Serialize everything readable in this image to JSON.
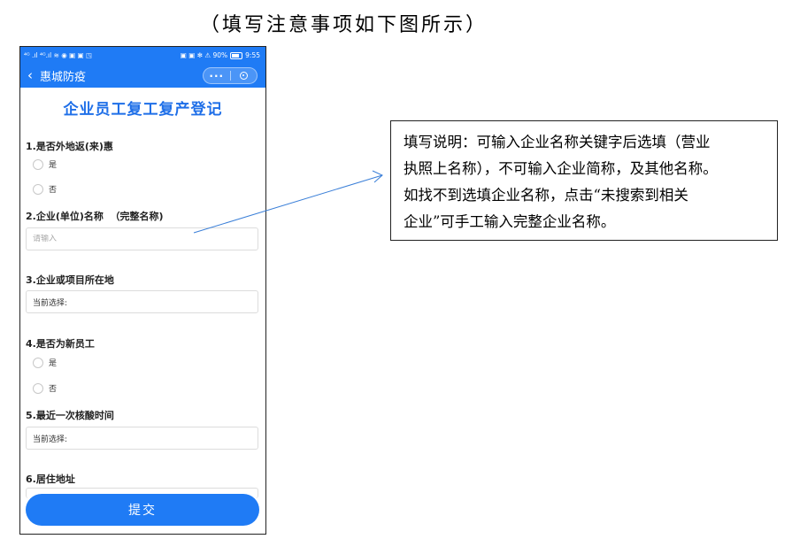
{
  "heading": "（填写注意事项如下图所示）",
  "phone": {
    "status_bar": {
      "left_text": "⁴ᴳ .ıl ⁴ᴳ.ıl ≋ ◉ ▣ ▣ ◳",
      "right_text": "▣ ▣ ✻ ⚠ 90%",
      "time": "9:55"
    },
    "nav": {
      "back_icon": "chevron-left-icon",
      "title": "惠城防疫",
      "more_label": "···",
      "close_icon": "target-icon"
    },
    "form": {
      "title": "企业员工复工复产登记",
      "q1": {
        "label": "1.是否外地返(来)惠",
        "options": [
          "是",
          "否"
        ]
      },
      "q2": {
        "label": "2.企业(单位)名称  （完整名称)",
        "placeholder": "请输入"
      },
      "q3": {
        "label": "3.企业或项目所在地",
        "value": "当前选择:"
      },
      "q4": {
        "label": "4.是否为新员工",
        "options": [
          "是",
          "否"
        ]
      },
      "q5": {
        "label": "5.最近一次核酸时间",
        "value": "当前选择:"
      },
      "q6": {
        "label": "6.居住地址"
      },
      "submit_label": "提交"
    },
    "colors": {
      "brand_blue": "#1f7bf5",
      "title_blue": "#1f6fe8"
    }
  },
  "note": {
    "lines": [
      "填写说明：可输入企业名称关键字后选填（营业",
      "执照上名称），不可输入企业简称，及其他名称。",
      "如找不到选填企业名称，点击“未搜索到相关",
      "企业”可手工输入完整企业名称。"
    ]
  }
}
